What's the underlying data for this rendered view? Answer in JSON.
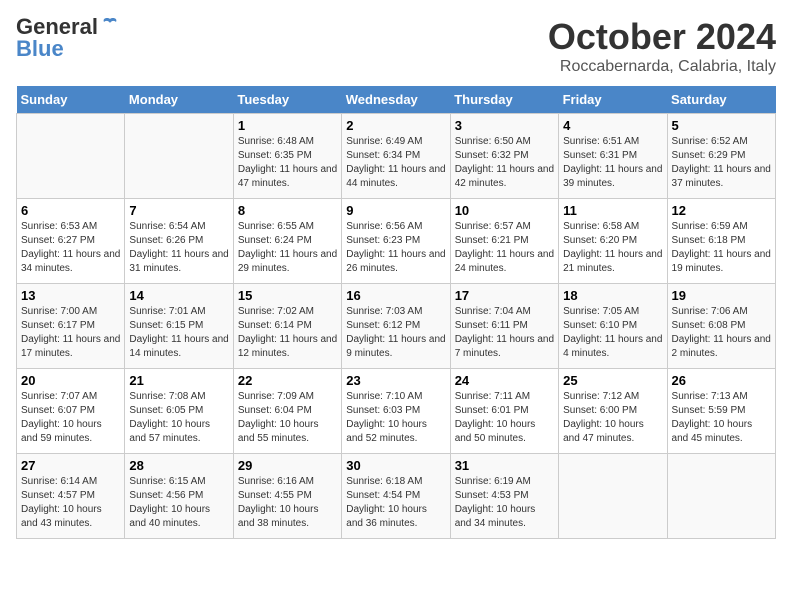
{
  "header": {
    "logo_general": "General",
    "logo_blue": "Blue",
    "month_title": "October 2024",
    "location": "Roccabernarda, Calabria, Italy"
  },
  "days_of_week": [
    "Sunday",
    "Monday",
    "Tuesday",
    "Wednesday",
    "Thursday",
    "Friday",
    "Saturday"
  ],
  "weeks": [
    [
      {
        "day": "",
        "info": ""
      },
      {
        "day": "",
        "info": ""
      },
      {
        "day": "1",
        "info": "Sunrise: 6:48 AM\nSunset: 6:35 PM\nDaylight: 11 hours and 47 minutes."
      },
      {
        "day": "2",
        "info": "Sunrise: 6:49 AM\nSunset: 6:34 PM\nDaylight: 11 hours and 44 minutes."
      },
      {
        "day": "3",
        "info": "Sunrise: 6:50 AM\nSunset: 6:32 PM\nDaylight: 11 hours and 42 minutes."
      },
      {
        "day": "4",
        "info": "Sunrise: 6:51 AM\nSunset: 6:31 PM\nDaylight: 11 hours and 39 minutes."
      },
      {
        "day": "5",
        "info": "Sunrise: 6:52 AM\nSunset: 6:29 PM\nDaylight: 11 hours and 37 minutes."
      }
    ],
    [
      {
        "day": "6",
        "info": "Sunrise: 6:53 AM\nSunset: 6:27 PM\nDaylight: 11 hours and 34 minutes."
      },
      {
        "day": "7",
        "info": "Sunrise: 6:54 AM\nSunset: 6:26 PM\nDaylight: 11 hours and 31 minutes."
      },
      {
        "day": "8",
        "info": "Sunrise: 6:55 AM\nSunset: 6:24 PM\nDaylight: 11 hours and 29 minutes."
      },
      {
        "day": "9",
        "info": "Sunrise: 6:56 AM\nSunset: 6:23 PM\nDaylight: 11 hours and 26 minutes."
      },
      {
        "day": "10",
        "info": "Sunrise: 6:57 AM\nSunset: 6:21 PM\nDaylight: 11 hours and 24 minutes."
      },
      {
        "day": "11",
        "info": "Sunrise: 6:58 AM\nSunset: 6:20 PM\nDaylight: 11 hours and 21 minutes."
      },
      {
        "day": "12",
        "info": "Sunrise: 6:59 AM\nSunset: 6:18 PM\nDaylight: 11 hours and 19 minutes."
      }
    ],
    [
      {
        "day": "13",
        "info": "Sunrise: 7:00 AM\nSunset: 6:17 PM\nDaylight: 11 hours and 17 minutes."
      },
      {
        "day": "14",
        "info": "Sunrise: 7:01 AM\nSunset: 6:15 PM\nDaylight: 11 hours and 14 minutes."
      },
      {
        "day": "15",
        "info": "Sunrise: 7:02 AM\nSunset: 6:14 PM\nDaylight: 11 hours and 12 minutes."
      },
      {
        "day": "16",
        "info": "Sunrise: 7:03 AM\nSunset: 6:12 PM\nDaylight: 11 hours and 9 minutes."
      },
      {
        "day": "17",
        "info": "Sunrise: 7:04 AM\nSunset: 6:11 PM\nDaylight: 11 hours and 7 minutes."
      },
      {
        "day": "18",
        "info": "Sunrise: 7:05 AM\nSunset: 6:10 PM\nDaylight: 11 hours and 4 minutes."
      },
      {
        "day": "19",
        "info": "Sunrise: 7:06 AM\nSunset: 6:08 PM\nDaylight: 11 hours and 2 minutes."
      }
    ],
    [
      {
        "day": "20",
        "info": "Sunrise: 7:07 AM\nSunset: 6:07 PM\nDaylight: 10 hours and 59 minutes."
      },
      {
        "day": "21",
        "info": "Sunrise: 7:08 AM\nSunset: 6:05 PM\nDaylight: 10 hours and 57 minutes."
      },
      {
        "day": "22",
        "info": "Sunrise: 7:09 AM\nSunset: 6:04 PM\nDaylight: 10 hours and 55 minutes."
      },
      {
        "day": "23",
        "info": "Sunrise: 7:10 AM\nSunset: 6:03 PM\nDaylight: 10 hours and 52 minutes."
      },
      {
        "day": "24",
        "info": "Sunrise: 7:11 AM\nSunset: 6:01 PM\nDaylight: 10 hours and 50 minutes."
      },
      {
        "day": "25",
        "info": "Sunrise: 7:12 AM\nSunset: 6:00 PM\nDaylight: 10 hours and 47 minutes."
      },
      {
        "day": "26",
        "info": "Sunrise: 7:13 AM\nSunset: 5:59 PM\nDaylight: 10 hours and 45 minutes."
      }
    ],
    [
      {
        "day": "27",
        "info": "Sunrise: 6:14 AM\nSunset: 4:57 PM\nDaylight: 10 hours and 43 minutes."
      },
      {
        "day": "28",
        "info": "Sunrise: 6:15 AM\nSunset: 4:56 PM\nDaylight: 10 hours and 40 minutes."
      },
      {
        "day": "29",
        "info": "Sunrise: 6:16 AM\nSunset: 4:55 PM\nDaylight: 10 hours and 38 minutes."
      },
      {
        "day": "30",
        "info": "Sunrise: 6:18 AM\nSunset: 4:54 PM\nDaylight: 10 hours and 36 minutes."
      },
      {
        "day": "31",
        "info": "Sunrise: 6:19 AM\nSunset: 4:53 PM\nDaylight: 10 hours and 34 minutes."
      },
      {
        "day": "",
        "info": ""
      },
      {
        "day": "",
        "info": ""
      }
    ]
  ]
}
